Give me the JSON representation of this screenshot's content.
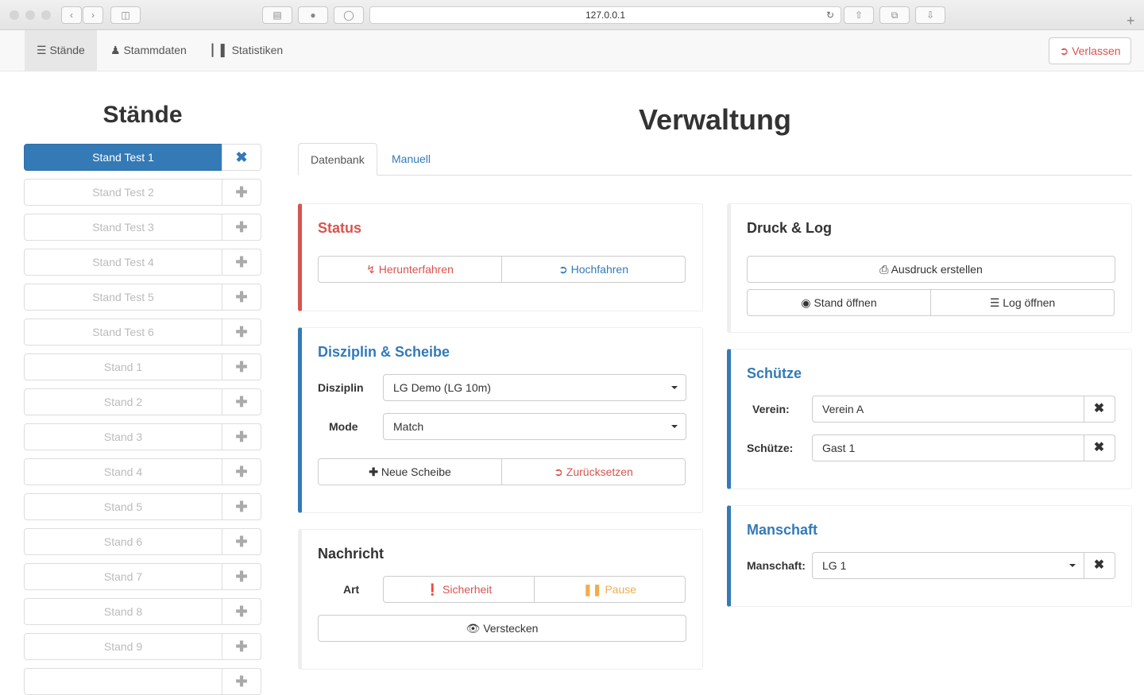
{
  "browser": {
    "url": "127.0.0.1"
  },
  "nav": {
    "items": [
      {
        "label": "Stände",
        "icon": "list-icon"
      },
      {
        "label": "Stammdaten",
        "icon": "user-icon"
      },
      {
        "label": "Statistiken",
        "icon": "bar-chart-icon"
      }
    ],
    "leave": "Verlassen"
  },
  "sidebar": {
    "title": "Stände",
    "stands": [
      "Stand Test 1",
      "Stand Test 2",
      "Stand Test 3",
      "Stand Test 4",
      "Stand Test 5",
      "Stand Test 6",
      "Stand 1",
      "Stand 2",
      "Stand 3",
      "Stand 4",
      "Stand 5",
      "Stand 6",
      "Stand 7",
      "Stand 8",
      "Stand 9",
      ""
    ],
    "selected": "Stand Test 1"
  },
  "main": {
    "title": "Verwaltung",
    "tabs": [
      "Datenbank",
      "Manuell"
    ],
    "status": {
      "title": "Status",
      "shutdown": "Herunterfahren",
      "startup": "Hochfahren"
    },
    "disziplin": {
      "title": "Disziplin & Scheibe",
      "disziplin_label": "Disziplin",
      "disziplin_value": "LG Demo (LG 10m)",
      "mode_label": "Mode",
      "mode_value": "Match",
      "new_target": "Neue Scheibe",
      "reset": "Zurücksetzen"
    },
    "nachricht": {
      "title": "Nachricht",
      "art_label": "Art",
      "safety": "Sicherheit",
      "pause": "Pause",
      "hide": "Verstecken"
    },
    "druck": {
      "title": "Druck & Log",
      "print": "Ausdruck erstellen",
      "open_stand": "Stand öffnen",
      "open_log": "Log öffnen"
    },
    "schuetze": {
      "title": "Schütze",
      "verein_label": "Verein:",
      "verein_value": "Verein A",
      "schuetze_label": "Schütze:",
      "schuetze_value": "Gast 1"
    },
    "manschaft": {
      "title": "Manschaft",
      "label": "Manschaft:",
      "value": "LG 1"
    }
  },
  "colors": {
    "primary": "#337ab7",
    "danger": "#d9534f",
    "warning": "#f0ad4e"
  }
}
